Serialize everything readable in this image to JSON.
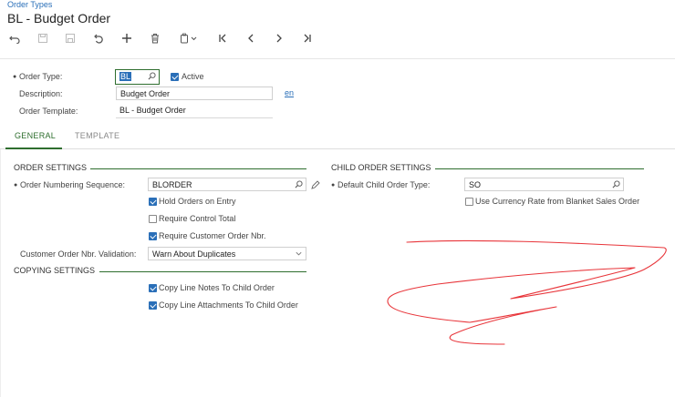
{
  "breadcrumb": "Order Types",
  "title": "BL - Budget Order",
  "toolbar": {
    "icons": [
      "undo-icon",
      "save-icon",
      "save-close-icon",
      "cancel-icon",
      "add-icon",
      "delete-icon",
      "copy-paste-icon",
      "first-record-icon",
      "previous-record-icon",
      "next-record-icon",
      "last-record-icon"
    ]
  },
  "header": {
    "order_type_label": "Order Type:",
    "order_type_value": "BL",
    "active_label": "Active",
    "description_label": "Description:",
    "description_value": "Budget Order",
    "language_link": "en",
    "order_template_label": "Order Template:",
    "order_template_value": "BL - Budget Order"
  },
  "tabs": [
    {
      "label": "GENERAL",
      "active": true
    },
    {
      "label": "TEMPLATE",
      "active": false
    }
  ],
  "order_settings": {
    "title": "ORDER SETTINGS",
    "numbering_label": "Order Numbering Sequence:",
    "numbering_value": "BLORDER",
    "hold_orders": "Hold Orders on Entry",
    "require_control_total": "Require Control Total",
    "require_customer_nbr": "Require Customer Order Nbr.",
    "validation_label": "Customer Order Nbr. Validation:",
    "validation_value": "Warn About Duplicates"
  },
  "copying_settings": {
    "title": "COPYING SETTINGS",
    "copy_notes": "Copy Line Notes To Child Order",
    "copy_attachments": "Copy Line Attachments To Child Order"
  },
  "child_order_settings": {
    "title": "CHILD ORDER SETTINGS",
    "default_type_label": "Default Child Order Type:",
    "default_type_value": "SO",
    "use_currency_rate": "Use Currency Rate from Blanket Sales Order"
  },
  "colors": {
    "accent": "#2a6fb8",
    "section": "#2e6e2e",
    "annotation": "#e8353a"
  }
}
